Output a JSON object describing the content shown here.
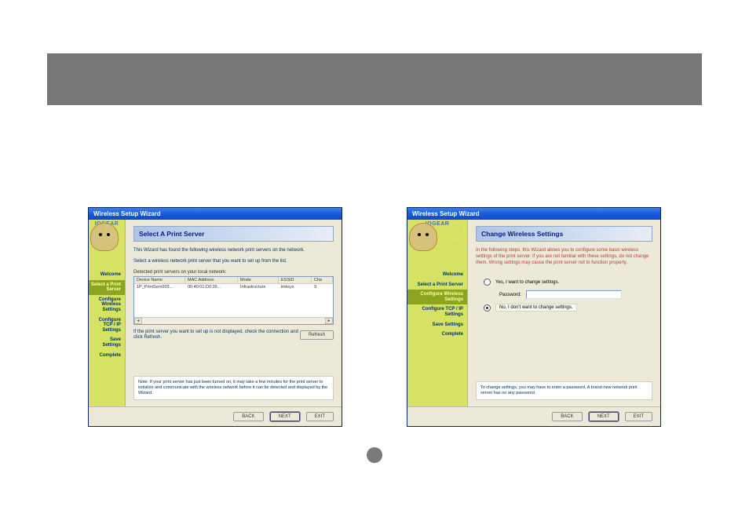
{
  "brand": "IOGEAR",
  "dialog_title": "Wireless Setup Wizard",
  "sidebar": {
    "items": [
      {
        "label": "Welcome"
      },
      {
        "label": "Select a Print Server"
      },
      {
        "label": "Configure Wireless Settings"
      },
      {
        "label": "Configure TCP / IP Settings"
      },
      {
        "label": "Save Settings"
      },
      {
        "label": "Complete"
      }
    ]
  },
  "left": {
    "panel_title": "Select A Print Server",
    "desc1": "This Wizard has found the following wireless network print servers on the network.",
    "desc2": "Select a wireless network print server that you want to set up from the list.",
    "list_label": "Detected print servers on your local network:",
    "table": {
      "headers": [
        "Device Name",
        "MAC Address",
        "Mode",
        "ESSID",
        "Cha"
      ],
      "widths": [
        58,
        60,
        45,
        35,
        20
      ],
      "row": [
        "1P_PrintServ003...",
        "00:40:01:D0:39...",
        "Infrastructure",
        "linksys",
        "9"
      ]
    },
    "refresh_note": "If the print server you want to set up is not displayed, check the connection and click Refresh.",
    "refresh_btn": "Refresh",
    "note": "Note: If your print server has just been turned on, it may take a few minutes for the print server to initialize and communicate with the wireless network before it can be detected and displayed by the Wizard."
  },
  "right": {
    "panel_title": "Change Wireless Settings",
    "desc": "In the following steps, this Wizard allows you to configure some basic wireless settings of the print server. If you are not familiar with these settings, do not change them. Wrong settings may cause the print server not to function properly.",
    "opt1": "Yes, I want to change settings.",
    "pwd_label": "Password:",
    "opt2": "No, I don't want to change settings.",
    "note": "To change settings, you may have to enter a password. A brand-new network print server has no any password."
  },
  "buttons": {
    "back": "BACK",
    "next": "NEXT",
    "exit": "EXIT"
  }
}
